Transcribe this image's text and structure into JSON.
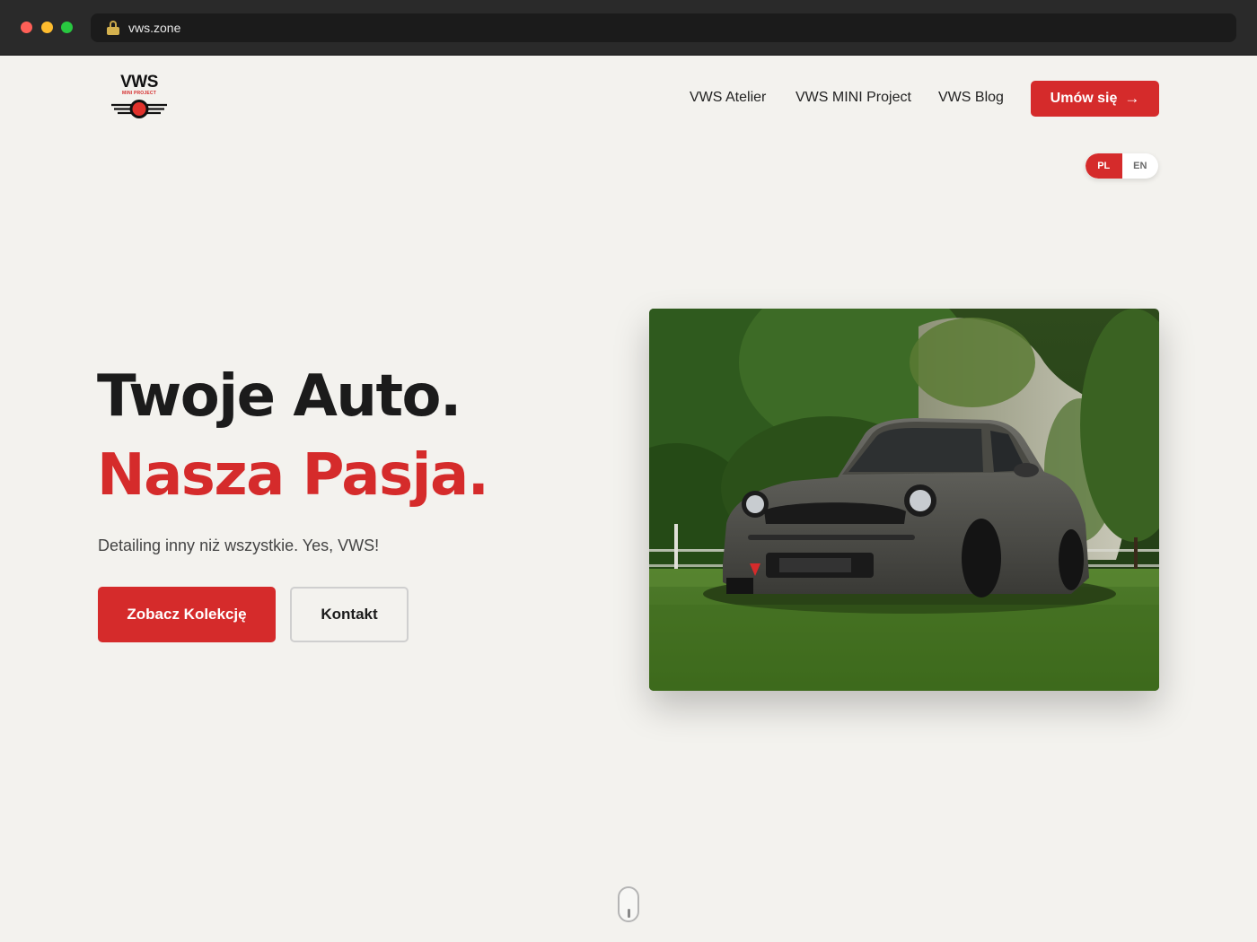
{
  "browser": {
    "url": "vws.zone"
  },
  "header": {
    "logo": {
      "brand": "VWS",
      "subtitle": "MINI PROJECT"
    },
    "nav": [
      {
        "label": "VWS Atelier"
      },
      {
        "label": "VWS MINI Project"
      },
      {
        "label": "VWS Blog"
      }
    ],
    "cta_label": "Umów się",
    "cta_arrow": "→"
  },
  "language": {
    "options": [
      "PL",
      "EN"
    ],
    "selected": "PL"
  },
  "hero": {
    "title_line1": "Twoje Auto.",
    "title_line2": "Nasza Pasja.",
    "tagline": "Detailing inny niż wszystkie. Yes, VWS!",
    "primary_button": "Zobacz Kolekcję",
    "secondary_button": "Kontakt"
  },
  "colors": {
    "accent": "#d52b2b",
    "background": "#f3f2ee",
    "text": "#1b1b1b"
  }
}
